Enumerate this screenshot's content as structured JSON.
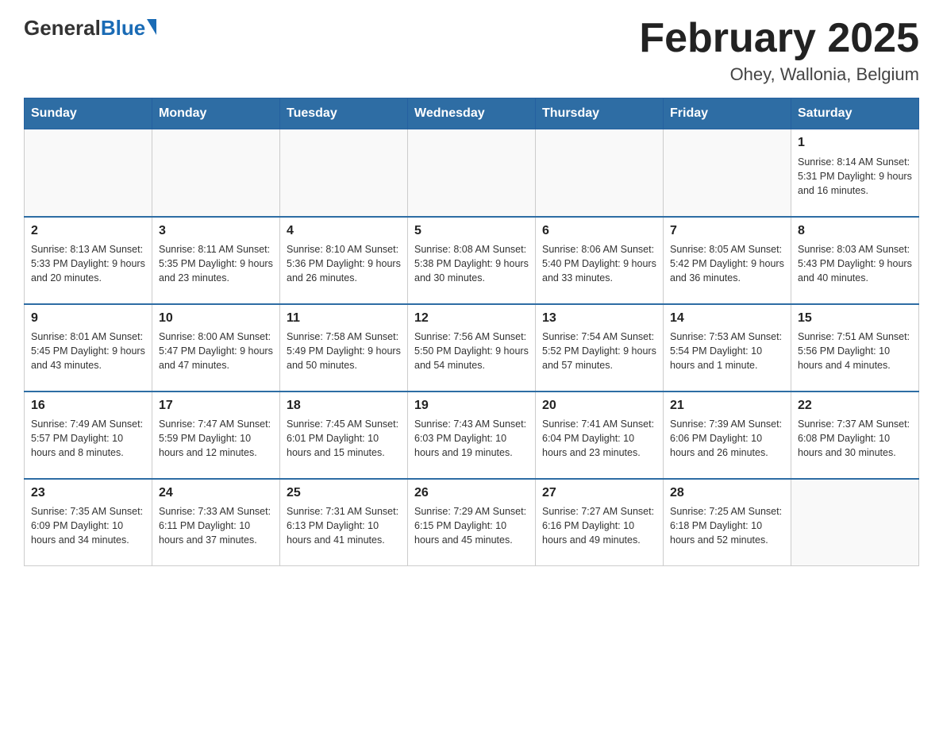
{
  "header": {
    "logo_general": "General",
    "logo_blue": "Blue",
    "month_title": "February 2025",
    "location": "Ohey, Wallonia, Belgium"
  },
  "weekdays": [
    "Sunday",
    "Monday",
    "Tuesday",
    "Wednesday",
    "Thursday",
    "Friday",
    "Saturday"
  ],
  "weeks": [
    [
      {
        "day": "",
        "info": ""
      },
      {
        "day": "",
        "info": ""
      },
      {
        "day": "",
        "info": ""
      },
      {
        "day": "",
        "info": ""
      },
      {
        "day": "",
        "info": ""
      },
      {
        "day": "",
        "info": ""
      },
      {
        "day": "1",
        "info": "Sunrise: 8:14 AM\nSunset: 5:31 PM\nDaylight: 9 hours and 16 minutes."
      }
    ],
    [
      {
        "day": "2",
        "info": "Sunrise: 8:13 AM\nSunset: 5:33 PM\nDaylight: 9 hours and 20 minutes."
      },
      {
        "day": "3",
        "info": "Sunrise: 8:11 AM\nSunset: 5:35 PM\nDaylight: 9 hours and 23 minutes."
      },
      {
        "day": "4",
        "info": "Sunrise: 8:10 AM\nSunset: 5:36 PM\nDaylight: 9 hours and 26 minutes."
      },
      {
        "day": "5",
        "info": "Sunrise: 8:08 AM\nSunset: 5:38 PM\nDaylight: 9 hours and 30 minutes."
      },
      {
        "day": "6",
        "info": "Sunrise: 8:06 AM\nSunset: 5:40 PM\nDaylight: 9 hours and 33 minutes."
      },
      {
        "day": "7",
        "info": "Sunrise: 8:05 AM\nSunset: 5:42 PM\nDaylight: 9 hours and 36 minutes."
      },
      {
        "day": "8",
        "info": "Sunrise: 8:03 AM\nSunset: 5:43 PM\nDaylight: 9 hours and 40 minutes."
      }
    ],
    [
      {
        "day": "9",
        "info": "Sunrise: 8:01 AM\nSunset: 5:45 PM\nDaylight: 9 hours and 43 minutes."
      },
      {
        "day": "10",
        "info": "Sunrise: 8:00 AM\nSunset: 5:47 PM\nDaylight: 9 hours and 47 minutes."
      },
      {
        "day": "11",
        "info": "Sunrise: 7:58 AM\nSunset: 5:49 PM\nDaylight: 9 hours and 50 minutes."
      },
      {
        "day": "12",
        "info": "Sunrise: 7:56 AM\nSunset: 5:50 PM\nDaylight: 9 hours and 54 minutes."
      },
      {
        "day": "13",
        "info": "Sunrise: 7:54 AM\nSunset: 5:52 PM\nDaylight: 9 hours and 57 minutes."
      },
      {
        "day": "14",
        "info": "Sunrise: 7:53 AM\nSunset: 5:54 PM\nDaylight: 10 hours and 1 minute."
      },
      {
        "day": "15",
        "info": "Sunrise: 7:51 AM\nSunset: 5:56 PM\nDaylight: 10 hours and 4 minutes."
      }
    ],
    [
      {
        "day": "16",
        "info": "Sunrise: 7:49 AM\nSunset: 5:57 PM\nDaylight: 10 hours and 8 minutes."
      },
      {
        "day": "17",
        "info": "Sunrise: 7:47 AM\nSunset: 5:59 PM\nDaylight: 10 hours and 12 minutes."
      },
      {
        "day": "18",
        "info": "Sunrise: 7:45 AM\nSunset: 6:01 PM\nDaylight: 10 hours and 15 minutes."
      },
      {
        "day": "19",
        "info": "Sunrise: 7:43 AM\nSunset: 6:03 PM\nDaylight: 10 hours and 19 minutes."
      },
      {
        "day": "20",
        "info": "Sunrise: 7:41 AM\nSunset: 6:04 PM\nDaylight: 10 hours and 23 minutes."
      },
      {
        "day": "21",
        "info": "Sunrise: 7:39 AM\nSunset: 6:06 PM\nDaylight: 10 hours and 26 minutes."
      },
      {
        "day": "22",
        "info": "Sunrise: 7:37 AM\nSunset: 6:08 PM\nDaylight: 10 hours and 30 minutes."
      }
    ],
    [
      {
        "day": "23",
        "info": "Sunrise: 7:35 AM\nSunset: 6:09 PM\nDaylight: 10 hours and 34 minutes."
      },
      {
        "day": "24",
        "info": "Sunrise: 7:33 AM\nSunset: 6:11 PM\nDaylight: 10 hours and 37 minutes."
      },
      {
        "day": "25",
        "info": "Sunrise: 7:31 AM\nSunset: 6:13 PM\nDaylight: 10 hours and 41 minutes."
      },
      {
        "day": "26",
        "info": "Sunrise: 7:29 AM\nSunset: 6:15 PM\nDaylight: 10 hours and 45 minutes."
      },
      {
        "day": "27",
        "info": "Sunrise: 7:27 AM\nSunset: 6:16 PM\nDaylight: 10 hours and 49 minutes."
      },
      {
        "day": "28",
        "info": "Sunrise: 7:25 AM\nSunset: 6:18 PM\nDaylight: 10 hours and 52 minutes."
      },
      {
        "day": "",
        "info": ""
      }
    ]
  ]
}
